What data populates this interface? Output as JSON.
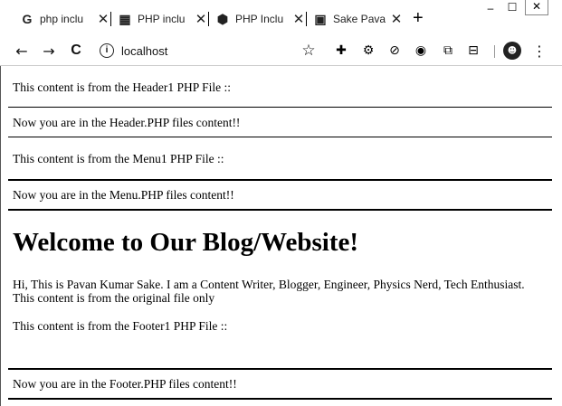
{
  "browser": {
    "tabs": [
      {
        "favicon": "G",
        "title": "php inclu",
        "close": "✕"
      },
      {
        "favicon": "▦",
        "title": "PHP inclu",
        "close": "✕"
      },
      {
        "favicon": "⬢",
        "title": "PHP Inclu",
        "close": "✕"
      },
      {
        "favicon": "▣",
        "title": "Sake Pava",
        "close": "✕"
      }
    ],
    "new_tab": "+",
    "window_controls": {
      "minimize": "–",
      "maximize": "☐",
      "close": "✕"
    },
    "nav": {
      "back": "←",
      "forward": "→",
      "reload": "C"
    },
    "address": "localhost",
    "address_info": "i",
    "bookmark_star": "☆",
    "extensions": [
      "✚",
      "⚙",
      "⊘",
      "◉",
      "⧉",
      "⊟"
    ],
    "avatar": "☻",
    "menu": "⋮"
  },
  "page": {
    "header1_text": "This content is from the Header1 PHP File ::",
    "header_text": "Now you are in the Header.PHP files content!!",
    "menu1_text": "This content is from the Menu1 PHP File ::",
    "menu_text": "Now you are in the Menu.PHP files content!!",
    "heading": "Welcome to Our Blog/Website!",
    "paragraph": "Hi, This is Pavan Kumar Sake. I am a Content Writer, Blogger, Engineer, Physics Nerd, Tech Enthusiast. This content is from the original file only",
    "footer1_text": "This content is from the Footer1 PHP File ::",
    "footer_text": "Now you are in the Footer.PHP files content!!"
  }
}
